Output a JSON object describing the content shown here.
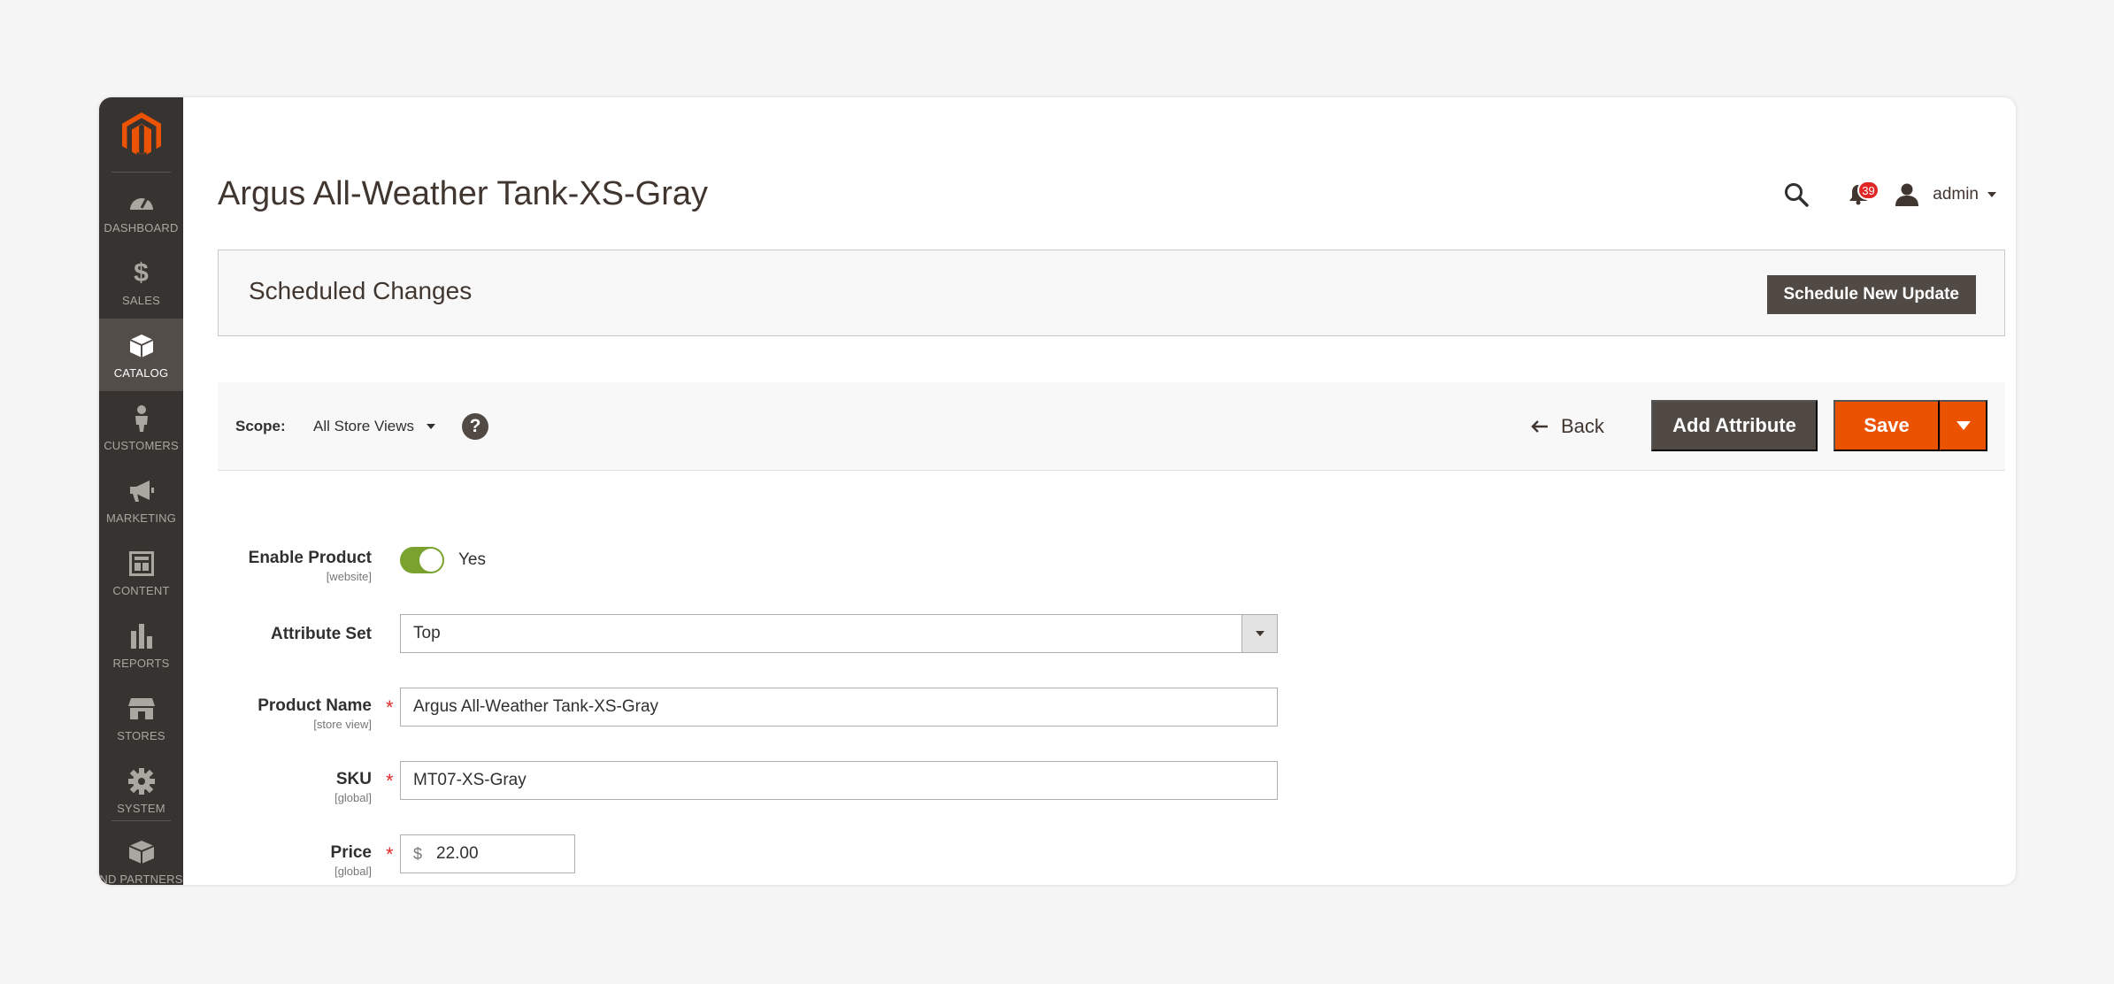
{
  "colors": {
    "sidebar_bg": "#373330",
    "sidebar_active": "#524d49",
    "logo": "#eb5202",
    "primary": "#eb5202",
    "secondary": "#514943",
    "toggle_on": "#79a22e",
    "badge": "#e22626"
  },
  "sidebar": {
    "items": [
      {
        "label": "DASHBOARD",
        "icon": "dashboard-icon"
      },
      {
        "label": "SALES",
        "icon": "dollar-icon"
      },
      {
        "label": "CATALOG",
        "icon": "box-icon",
        "active": true
      },
      {
        "label": "CUSTOMERS",
        "icon": "person-icon"
      },
      {
        "label": "MARKETING",
        "icon": "megaphone-icon"
      },
      {
        "label": "CONTENT",
        "icon": "layout-icon"
      },
      {
        "label": "REPORTS",
        "icon": "bar-chart-icon"
      },
      {
        "label": "STORES",
        "icon": "store-icon"
      },
      {
        "label": "SYSTEM",
        "icon": "gear-icon"
      },
      {
        "label": "ND PARTNERS",
        "icon": "partners-icon"
      }
    ]
  },
  "header": {
    "title": "Argus All-Weather Tank-XS-Gray",
    "notifications_count": "39",
    "user_name": "admin"
  },
  "scheduled": {
    "title": "Scheduled Changes",
    "button": "Schedule New Update"
  },
  "actionbar": {
    "scope_label": "Scope:",
    "scope_value": "All Store Views",
    "help": "?",
    "back": "Back",
    "add_attribute": "Add Attribute",
    "save": "Save"
  },
  "form": {
    "enable_product": {
      "label": "Enable Product",
      "scope": "[website]",
      "value": "Yes"
    },
    "attribute_set": {
      "label": "Attribute Set",
      "value": "Top"
    },
    "product_name": {
      "label": "Product Name",
      "scope": "[store view]",
      "value": "Argus All-Weather Tank-XS-Gray"
    },
    "sku": {
      "label": "SKU",
      "scope": "[global]",
      "value": "MT07-XS-Gray"
    },
    "price": {
      "label": "Price",
      "scope": "[global]",
      "currency": "$",
      "value": "22.00"
    }
  }
}
